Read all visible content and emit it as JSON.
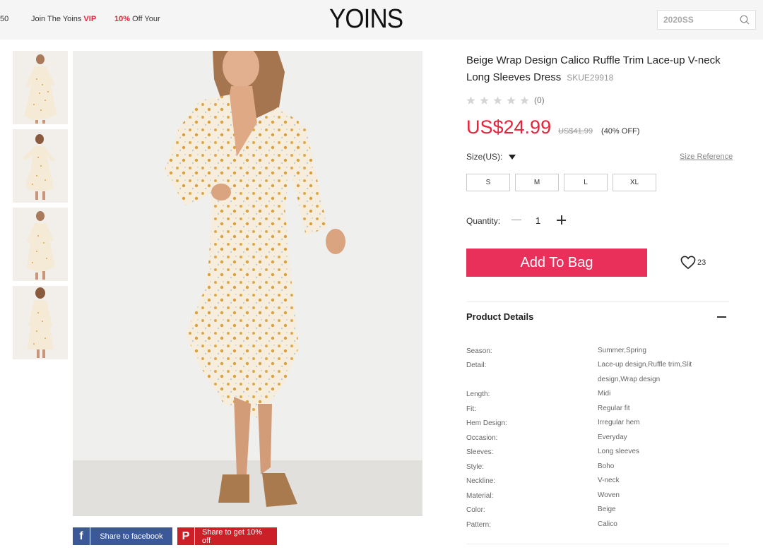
{
  "header": {
    "promo_left": "50",
    "promo_vip_prefix": "Join The Yoins ",
    "promo_vip_highlight": "VIP",
    "promo_off_highlight": "10%",
    "promo_off_suffix": " Off Your",
    "logo": "YOINS",
    "search_placeholder": "2020SS"
  },
  "share": {
    "facebook_label": "Share to facebook",
    "pinterest_label": "Share to get 10% off"
  },
  "product": {
    "title": "Beige Wrap Design Calico Ruffle Trim Lace-up V-neck Long Sleeves Dress",
    "sku": "SKUE29918",
    "rating_count": "(0)",
    "rating_value": 0,
    "price": "US$24.99",
    "original_price": "US$41.99",
    "discount": "(40% OFF)"
  },
  "size": {
    "label": "Size(US):",
    "reference": "Size Reference",
    "options": [
      "S",
      "M",
      "L",
      "XL"
    ]
  },
  "quantity": {
    "label": "Quantity:",
    "value": "1"
  },
  "actions": {
    "add_to_bag": "Add To Bag",
    "wishlist_count": "23"
  },
  "details": {
    "title": "Product Details",
    "specs": [
      {
        "key": "Season:",
        "value": "Summer,Spring"
      },
      {
        "key": "Detail:",
        "value": "Lace-up design,Ruffle trim,Slit design,Wrap design"
      },
      {
        "key": "Length:",
        "value": "Midi"
      },
      {
        "key": "Fit:",
        "value": "Regular fit"
      },
      {
        "key": "Hem Design:",
        "value": "Irregular hem"
      },
      {
        "key": "Occasion:",
        "value": "Everyday"
      },
      {
        "key": "Sleeves:",
        "value": "Long sleeves"
      },
      {
        "key": "Style:",
        "value": "Boho"
      },
      {
        "key": "Neckline:",
        "value": "V-neck"
      },
      {
        "key": "Material:",
        "value": "Woven"
      },
      {
        "key": "Color:",
        "value": "Beige"
      },
      {
        "key": "Pattern:",
        "value": "Calico"
      }
    ]
  },
  "colors": {
    "accent_red": "#e8223a",
    "add_bag_bg": "#e8305a",
    "facebook": "#3b5998",
    "pinterest": "#cb2027"
  }
}
